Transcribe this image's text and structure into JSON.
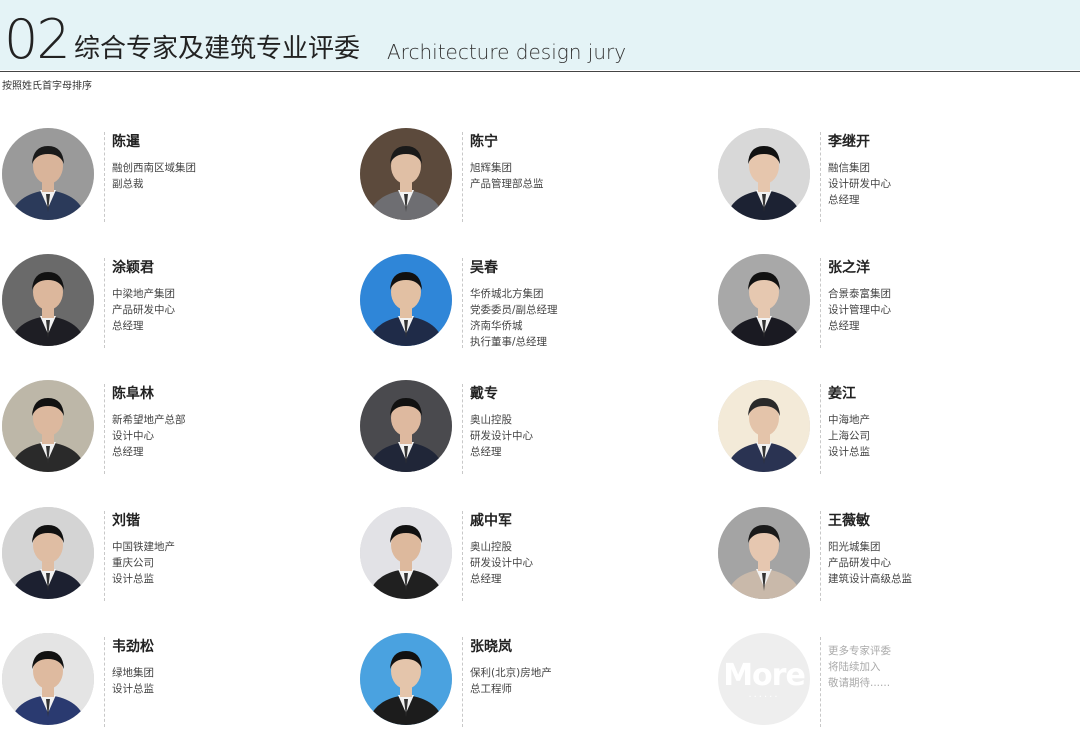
{
  "header": {
    "number": "02",
    "title_cn": "综合专家及建筑专业评委",
    "title_en": "Architecture design jury",
    "sort_note": "按照姓氏首字母排序"
  },
  "jurors": [
    {
      "name": "陈暹",
      "lines": [
        "融创西南区域集团",
        "副总裁"
      ],
      "bg": "#9a9a9a",
      "suit": "#2b3a5a",
      "hair": "#1a1a1a",
      "skin": "#d9b49a"
    },
    {
      "name": "陈宁",
      "lines": [
        "旭辉集团",
        "产品管理部总监"
      ],
      "bg": "#5c4a3c",
      "suit": "#6e6e72",
      "hair": "#1a1a1a",
      "skin": "#e0bfa5"
    },
    {
      "name": "李继开",
      "lines": [
        "融信集团",
        "设计研发中心",
        "总经理"
      ],
      "bg": "#d8d8d8",
      "suit": "#1c2233",
      "hair": "#111",
      "skin": "#e6c6ad"
    },
    {
      "name": "涂颖君",
      "lines": [
        "中梁地产集团",
        "产品研发中心",
        "总经理"
      ],
      "bg": "#6a6a6a",
      "suit": "#1e1e24",
      "hair": "#111",
      "skin": "#dcb79c"
    },
    {
      "name": "吴春",
      "lines": [
        "华侨城北方集团",
        "党委委员/副总经理",
        "济南华侨城",
        "执行董事/总经理"
      ],
      "bg": "#2f86d8",
      "suit": "#1f2b48",
      "hair": "#111",
      "skin": "#e2c0a3"
    },
    {
      "name": "张之洋",
      "lines": [
        "合景泰富集团",
        "设计管理中心",
        "总经理"
      ],
      "bg": "#a8a8a8",
      "suit": "#1a1a22",
      "hair": "#111",
      "skin": "#e6c8b0"
    },
    {
      "name": "陈阜林",
      "lines": [
        "新希望地产总部",
        "设计中心",
        "总经理"
      ],
      "bg": "#bdb7a8",
      "suit": "#2a2a2a",
      "hair": "#111",
      "skin": "#dcb89e"
    },
    {
      "name": "戴专",
      "lines": [
        "奥山控股",
        "研发设计中心",
        "总经理"
      ],
      "bg": "#4a4a4e",
      "suit": "#202638",
      "hair": "#111",
      "skin": "#deb99f"
    },
    {
      "name": "姜江",
      "lines": [
        "中海地产",
        "上海公司",
        "设计总监"
      ],
      "bg": "#f3ead8",
      "suit": "#2a3352",
      "hair": "#2a2a2a",
      "skin": "#e4c4aa"
    },
    {
      "name": "刘锴",
      "lines": [
        "中国铁建地产",
        "重庆公司",
        "设计总监"
      ],
      "bg": "#d4d4d4",
      "suit": "#1c2030",
      "hair": "#111",
      "skin": "#dfbda3"
    },
    {
      "name": "戚中军",
      "lines": [
        "奥山控股",
        "研发设计中心",
        "总经理"
      ],
      "bg": "#e2e2e6",
      "suit": "#202020",
      "hair": "#111",
      "skin": "#ddb99d"
    },
    {
      "name": "王薇敏",
      "lines": [
        "阳光城集团",
        "产品研发中心",
        "建筑设计高级总监"
      ],
      "bg": "#a4a4a4",
      "suit": "#c9b9aa",
      "hair": "#1a1a1a",
      "skin": "#e6c7b0"
    },
    {
      "name": "韦劲松",
      "lines": [
        "绿地集团",
        "设计总监"
      ],
      "bg": "#e4e4e4",
      "suit": "#2a3a70",
      "hair": "#111",
      "skin": "#deba9f"
    },
    {
      "name": "张晓岚",
      "lines": [
        "保利(北京)房地产",
        "总工程师"
      ],
      "bg": "#4aa2e0",
      "suit": "#1c1c1c",
      "hair": "#111",
      "skin": "#e4c5ab"
    }
  ],
  "more": {
    "label": "More",
    "dots": "......",
    "lines": [
      "更多专家评委",
      "将陆续加入",
      "敬请期待......"
    ]
  }
}
